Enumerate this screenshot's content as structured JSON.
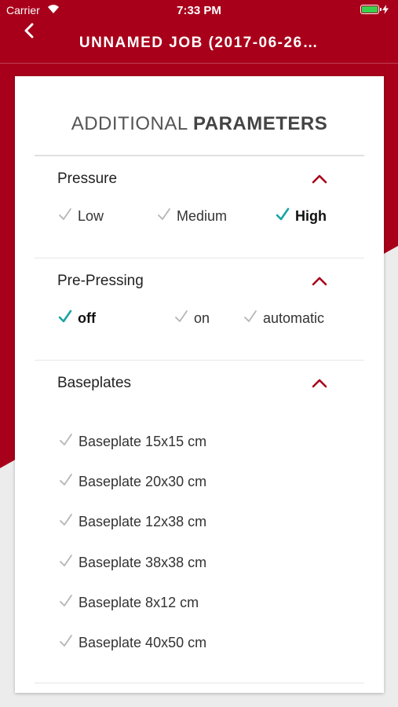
{
  "colors": {
    "brand": "#a8001a",
    "accent_check": "#1aa3a3",
    "inactive_check": "#b5b5b5"
  },
  "status_bar": {
    "carrier": "Carrier",
    "time": "7:33 PM"
  },
  "navbar": {
    "title": "UNNAMED JOB (2017-06-26…",
    "back_icon": "chevron-left-icon"
  },
  "card": {
    "title_light": "ADDITIONAL ",
    "title_bold": "PARAMETERS"
  },
  "pressure": {
    "title": "Pressure",
    "options": [
      {
        "label": "Low",
        "selected": false
      },
      {
        "label": "Medium",
        "selected": false
      },
      {
        "label": "High",
        "selected": true
      }
    ]
  },
  "pre_pressing": {
    "title": "Pre-Pressing",
    "options": [
      {
        "label": "off",
        "selected": true
      },
      {
        "label": "on",
        "selected": false
      },
      {
        "label": "automatic",
        "selected": false
      }
    ]
  },
  "baseplates": {
    "title": "Baseplates",
    "items": [
      {
        "label": "Baseplate 15x15 cm",
        "selected": false
      },
      {
        "label": "Baseplate 20x30 cm",
        "selected": false
      },
      {
        "label": "Baseplate 12x38 cm",
        "selected": false
      },
      {
        "label": "Baseplate 38x38 cm",
        "selected": false
      },
      {
        "label": "Baseplate 8x12 cm",
        "selected": false
      },
      {
        "label": "Baseplate 40x50 cm",
        "selected": false
      }
    ]
  }
}
